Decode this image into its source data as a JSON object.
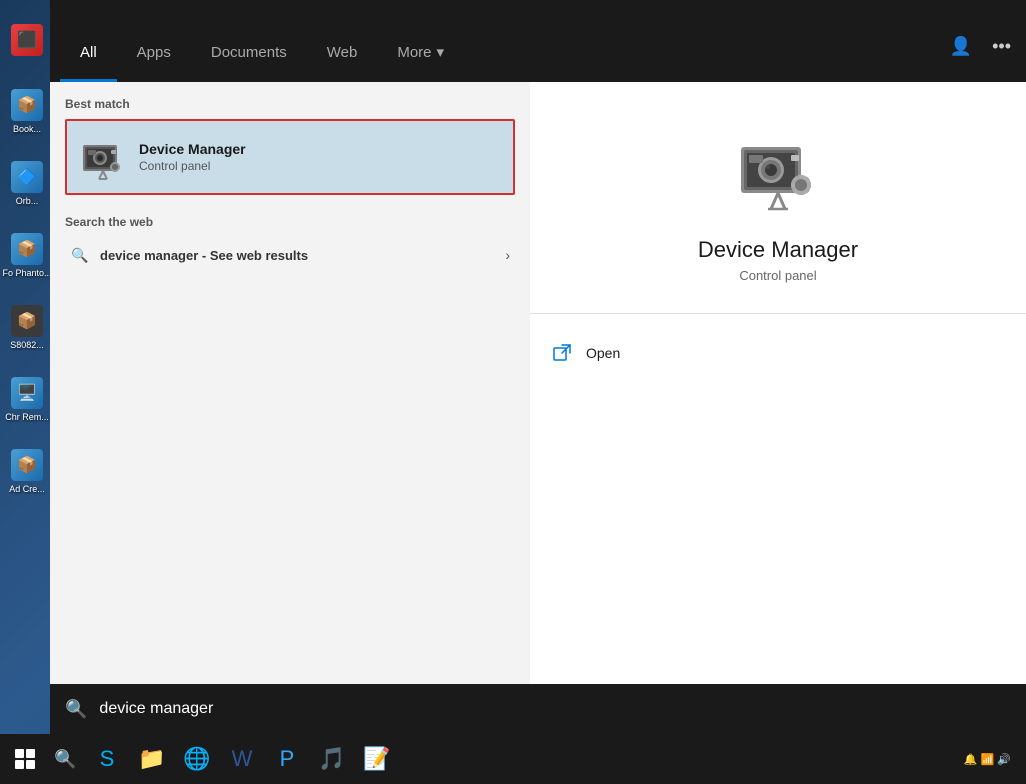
{
  "tabs": {
    "all": "All",
    "apps": "Apps",
    "documents": "Documents",
    "web": "Web",
    "more": "More",
    "more_arrow": "▾"
  },
  "topbar": {
    "user_icon": "👤",
    "more_icon": "•••"
  },
  "best_match": {
    "label": "Best match",
    "app_name": "Device Manager",
    "app_subtitle": "Control panel"
  },
  "web_search": {
    "label": "Search the web",
    "query": "device manager",
    "suffix": " - See web results"
  },
  "right_panel": {
    "app_name": "Device Manager",
    "app_subtitle": "Control panel",
    "open_label": "Open"
  },
  "search_bar": {
    "query": "device manager",
    "placeholder": "device manager"
  },
  "taskbar": {
    "apps": [
      "🔵",
      "S",
      "📁",
      "🌐",
      "W",
      "P",
      "🎵",
      "📝"
    ]
  },
  "desktop_icons": [
    {
      "label": "Book\n...",
      "color": "#4a9fd4"
    },
    {
      "label": "Orb\n...",
      "color": "#4a9fd4"
    },
    {
      "label": "Fo\nPhanto...",
      "color": "#4a9fd4"
    },
    {
      "label": "S808\n2...",
      "color": "#5a5a5a"
    },
    {
      "label": "Chr\nRem...",
      "color": "#4a9fd4"
    },
    {
      "label": "Ad\nCre...",
      "color": "#4a9fd4"
    }
  ]
}
